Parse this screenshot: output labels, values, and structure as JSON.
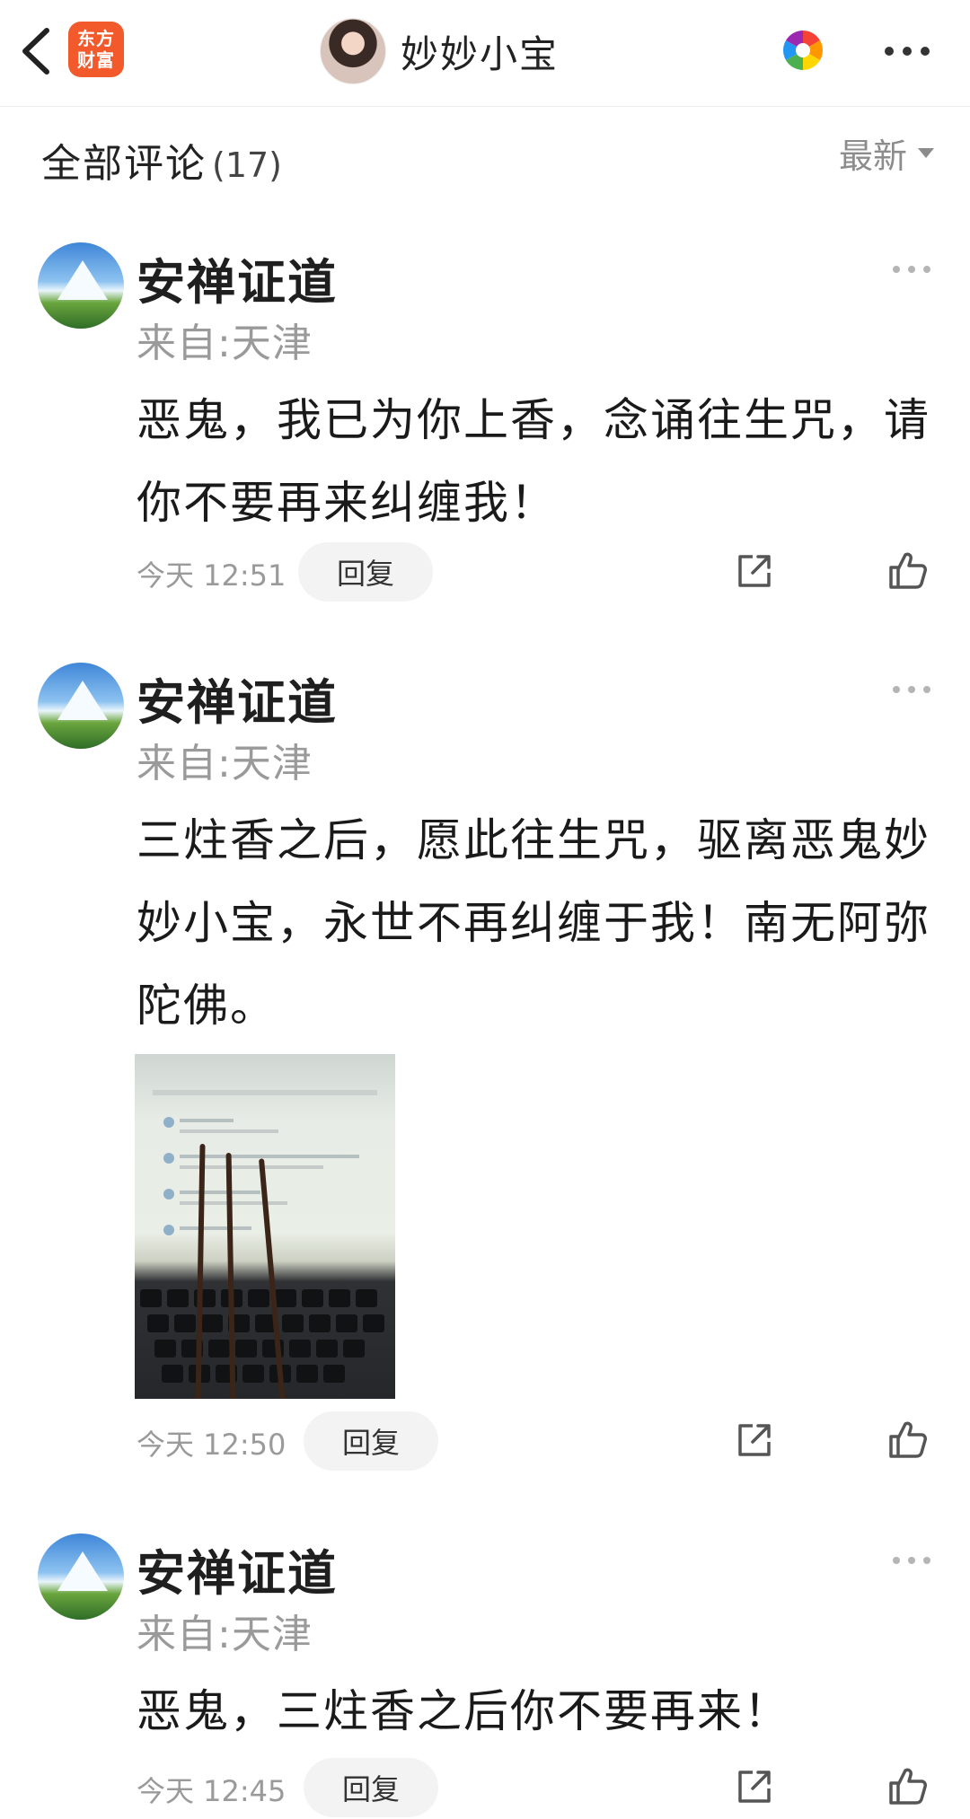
{
  "nav": {
    "logo_line1": "东方",
    "logo_line2": "财富",
    "title": "妙妙小宝"
  },
  "section": {
    "title": "全部评论",
    "count": "(17)",
    "sort_label": "最新"
  },
  "comments": [
    {
      "name": "安禅证道",
      "location": "来自:天津",
      "text": "恶鬼，我已为你上香，念诵往生咒，请你不要再来纠缠我！",
      "time": "今天 12:51",
      "reply_label": "回复"
    },
    {
      "name": "安禅证道",
      "location": "来自:天津",
      "text": "三炷香之后，愿此往生咒，驱离恶鬼妙妙小宝，永世不再纠缠于我！南无阿弥陀佛。",
      "time": "今天 12:50",
      "reply_label": "回复"
    },
    {
      "name": "安禅证道",
      "location": "来自:天津",
      "text": "恶鬼，三炷香之后你不要再来！",
      "time": "今天 12:45",
      "reply_label": "回复"
    }
  ]
}
